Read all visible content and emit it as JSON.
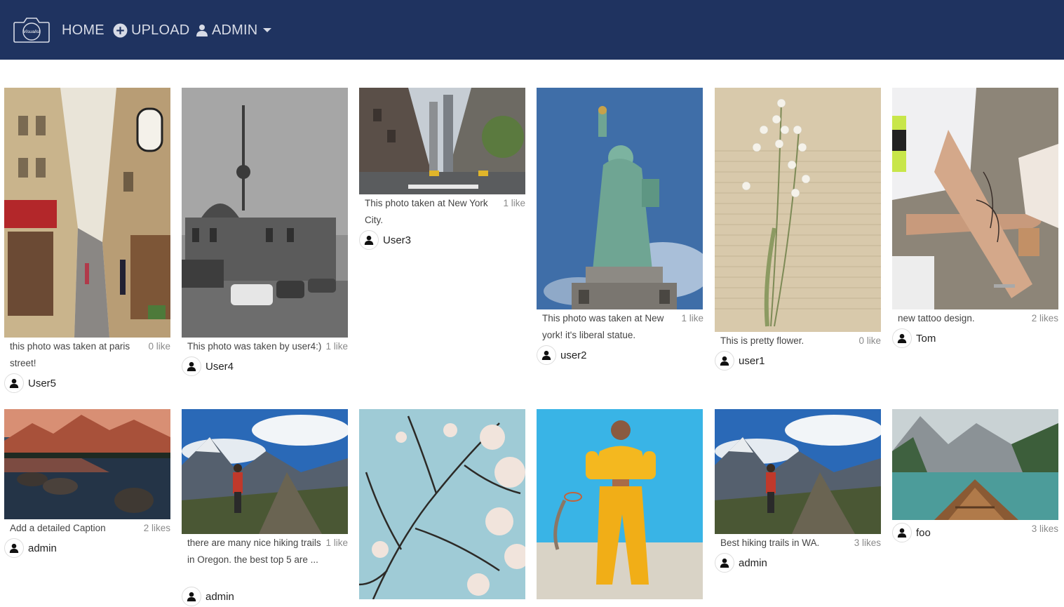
{
  "nav": {
    "logo_text": "Visualist",
    "home": "HOME",
    "upload": "UPLOAD",
    "admin": "ADMIN"
  },
  "posts": [
    {
      "caption": "this photo was taken at paris street!",
      "likes": "0 like",
      "user": "User5"
    },
    {
      "caption": "This photo was taken by user4:)",
      "likes": "1 like",
      "user": "User4"
    },
    {
      "caption": "This photo taken at New York City.",
      "likes": "1 like",
      "user": "User3"
    },
    {
      "caption": "This photo was taken at New york! it's liberal statue.",
      "likes": "1 like",
      "user": "user2"
    },
    {
      "caption": "This is pretty flower.",
      "likes": "0 like",
      "user": "user1"
    },
    {
      "caption": "new tattoo design.",
      "likes": "2 likes",
      "user": "Tom"
    },
    {
      "caption": "Add a detailed Caption",
      "likes": "2 likes",
      "user": "admin"
    },
    {
      "caption": "there are many nice hiking trails in Oregon. the best top 5 are ...",
      "likes": "1 like",
      "user": "admin"
    },
    {
      "caption": "",
      "likes": "",
      "user": ""
    },
    {
      "caption": "",
      "likes": "",
      "user": ""
    },
    {
      "caption": "Best hiking trails in WA.",
      "likes": "3 likes",
      "user": "admin"
    },
    {
      "caption": "",
      "likes": "3 likes",
      "user": "foo"
    }
  ],
  "colors": {
    "navbar": "#1f3360",
    "nav_text": "#d7dbe6"
  }
}
